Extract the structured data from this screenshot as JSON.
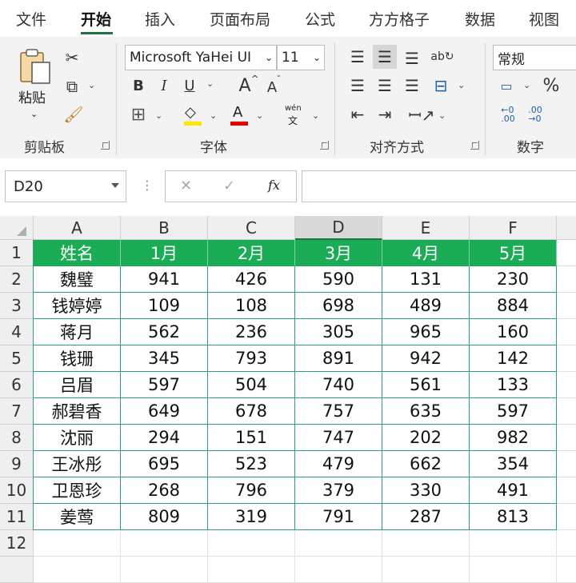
{
  "tabs": [
    "文件",
    "开始",
    "插入",
    "页面布局",
    "公式",
    "方方格子",
    "数据",
    "视图"
  ],
  "ribbon": {
    "clipboard": {
      "paste_label": "粘贴",
      "group_label": "剪贴板"
    },
    "font": {
      "font_name": "Microsoft YaHei UI",
      "font_size": "11",
      "group_label": "字体",
      "bold": "B",
      "italic": "I",
      "underline": "U",
      "grow": "A",
      "shrink": "A",
      "phonetic_top": "wén",
      "phonetic_bottom": "文"
    },
    "alignment": {
      "group_label": "对齐方式"
    },
    "number": {
      "format": "常规",
      "group_label": "数字",
      "percent": "%"
    }
  },
  "formula_bar": {
    "name_box": "D20",
    "cancel": "✕",
    "enter": "✓",
    "fx": "fx",
    "formula": ""
  },
  "columns": [
    "A",
    "B",
    "C",
    "D",
    "E",
    "F"
  ],
  "selected_column": "D",
  "rows": [
    "1",
    "2",
    "3",
    "4",
    "5",
    "6",
    "7",
    "8",
    "9",
    "10",
    "11",
    "12",
    ""
  ],
  "table": {
    "headers": [
      "姓名",
      "1月",
      "2月",
      "3月",
      "4月",
      "5月"
    ],
    "data": [
      [
        "魏璧",
        "941",
        "426",
        "590",
        "131",
        "230"
      ],
      [
        "钱婷婷",
        "109",
        "108",
        "698",
        "489",
        "884"
      ],
      [
        "蒋月",
        "562",
        "236",
        "305",
        "965",
        "160"
      ],
      [
        "钱珊",
        "345",
        "793",
        "891",
        "942",
        "142"
      ],
      [
        "吕眉",
        "597",
        "504",
        "740",
        "561",
        "133"
      ],
      [
        "郝碧香",
        "649",
        "678",
        "757",
        "635",
        "597"
      ],
      [
        "沈丽",
        "294",
        "151",
        "747",
        "202",
        "982"
      ],
      [
        "王冰彤",
        "695",
        "523",
        "479",
        "662",
        "354"
      ],
      [
        "卫恩珍",
        "268",
        "796",
        "379",
        "330",
        "491"
      ],
      [
        "姜莺",
        "809",
        "319",
        "791",
        "287",
        "813"
      ]
    ]
  },
  "colors": {
    "header_fill": "#1aad55",
    "border": "#2a9d8f",
    "accent": "#217346"
  }
}
